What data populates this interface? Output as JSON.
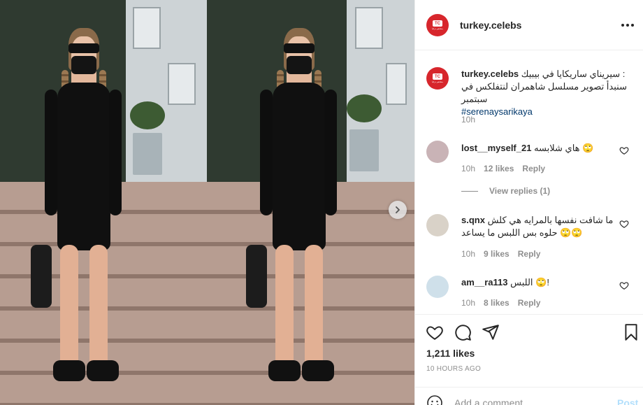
{
  "post": {
    "username": "turkey.celebs",
    "avatar_text": "TC",
    "avatar_sub": "مشاهير تركيا",
    "caption_line1": "سيريناي ساريكايا في بيبيك :",
    "caption_line2": "سنبدأ تصوير مسلسل شاهمران لنتفلكس في سبتمبر",
    "caption_tag": "#serenaysarikaya",
    "caption_time": "10h"
  },
  "comments": [
    {
      "user": "lost__myself_21",
      "text": "هاي شلابسه 🙄",
      "time": "10h",
      "likes": "12 likes",
      "reply": "Reply"
    },
    {
      "user": "s.qnx",
      "text": "ما شافت نفسها بالمرايه هي كلش حلوه بس اللبس ما يساعد 🙄🙄",
      "time": "10h",
      "likes": "9 likes",
      "reply": "Reply"
    },
    {
      "user": "am__ra113",
      "text": "اللبس 🙄!",
      "time": "10h",
      "likes": "8 likes",
      "reply": "Reply"
    }
  ],
  "view_replies": "View replies (1)",
  "stats": {
    "likes": "1,211 likes",
    "ago": "10 HOURS AGO"
  },
  "add_comment": {
    "placeholder": "Add a comment...",
    "post_label": "Post"
  },
  "icons": {
    "more": "more-options-icon",
    "like": "heart-icon",
    "comment": "comment-icon",
    "share": "paper-plane-icon",
    "save": "bookmark-icon",
    "emoji": "emoji-icon",
    "next": "chevron-right-icon"
  }
}
